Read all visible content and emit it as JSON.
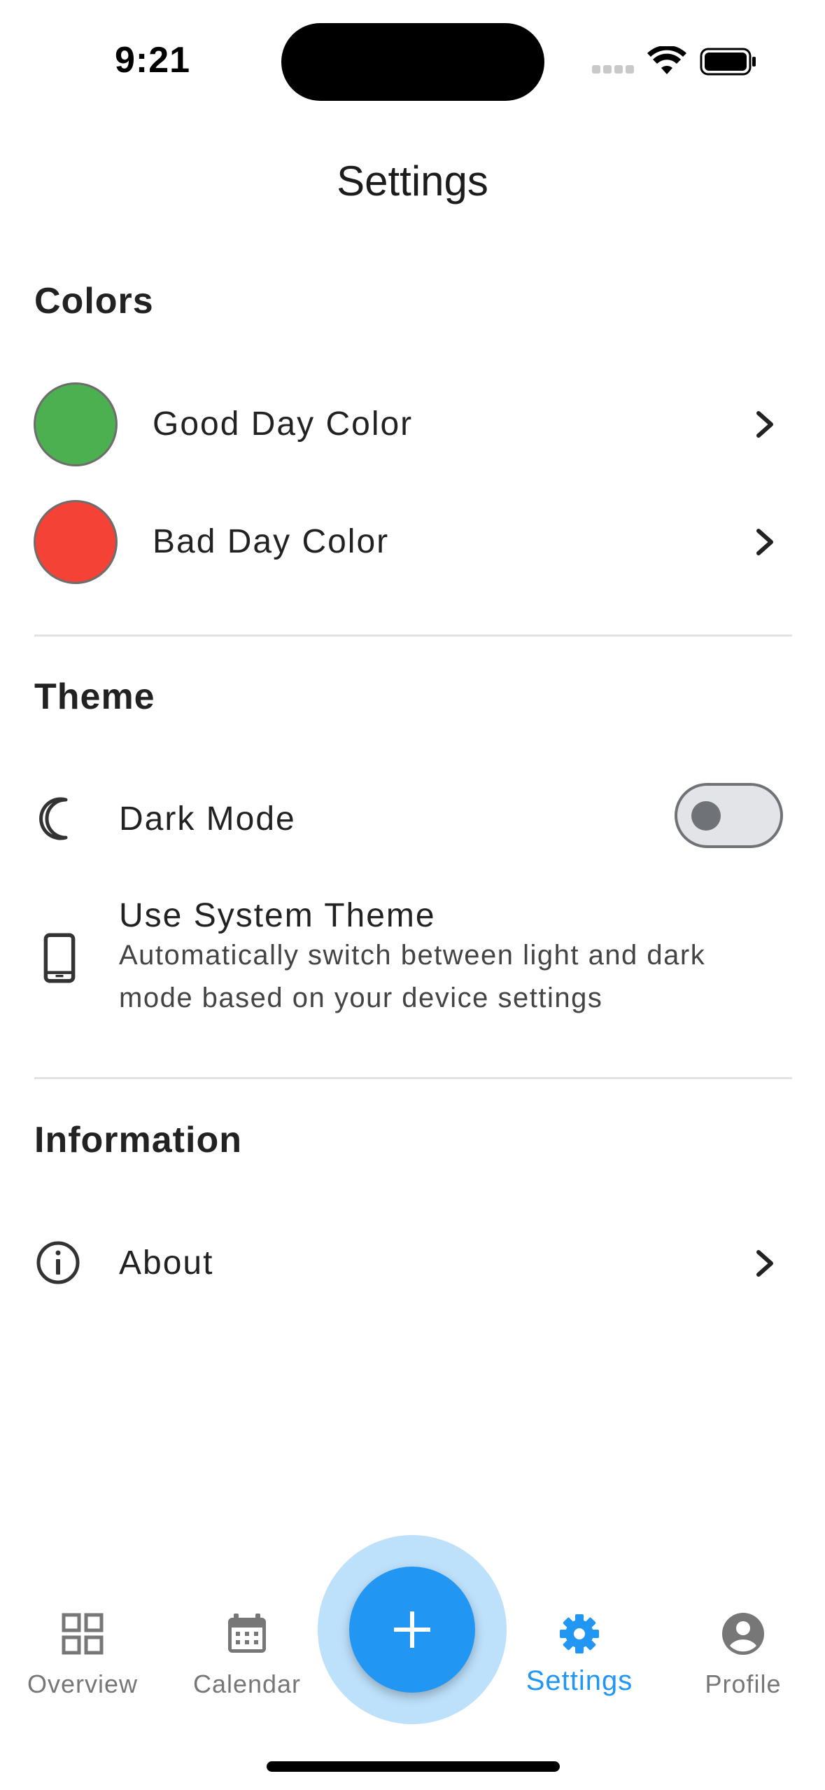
{
  "status_bar": {
    "time": "9:21"
  },
  "header": {
    "title": "Settings"
  },
  "colors_section": {
    "title": "Colors",
    "items": [
      {
        "label": "Good Day Color",
        "color": "#4caf50",
        "icon": "chevron-right-icon"
      },
      {
        "label": "Bad Day Color",
        "color": "#f44336",
        "icon": "chevron-right-icon"
      }
    ]
  },
  "theme_section": {
    "title": "Theme",
    "dark_mode": {
      "label": "Dark Mode",
      "icon": "moon-icon",
      "enabled": false
    },
    "system_theme": {
      "label": "Use System Theme",
      "description": "Automatically switch between light and dark mode based on your device settings",
      "icon": "phone-icon"
    }
  },
  "information_section": {
    "title": "Information",
    "about": {
      "label": "About",
      "icon": "info-icon"
    }
  },
  "bottom_nav": {
    "items": [
      {
        "label": "Overview",
        "icon": "grid-icon",
        "active": false
      },
      {
        "label": "Calendar",
        "icon": "calendar-icon",
        "active": false
      },
      {
        "label": "Settings",
        "icon": "gear-icon",
        "active": true
      },
      {
        "label": "Profile",
        "icon": "account-circle-icon",
        "active": false
      }
    ],
    "fab_icon": "plus-icon"
  },
  "theme_colors": {
    "accent": "#2196f3",
    "accent_light": "#bde0fb"
  }
}
